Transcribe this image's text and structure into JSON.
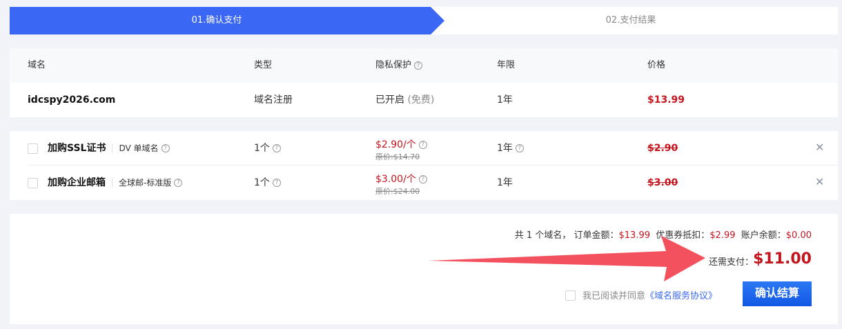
{
  "steps": {
    "step1": "01.确认支付",
    "step2": "02.支付结果"
  },
  "domain_table": {
    "headers": {
      "domain": "域名",
      "type": "类型",
      "privacy": "隐私保护",
      "years": "年限",
      "price": "价格"
    },
    "row": {
      "domain": "idcspy2026.com",
      "type": "域名注册",
      "privacy": "已开启",
      "privacy_note": "(免费)",
      "years": "1年",
      "price": "$13.99"
    }
  },
  "addons": [
    {
      "title": "加购SSL证书",
      "sub": "DV 单域名",
      "qty": "1个",
      "price": "$2.90/个",
      "original": "原价:$14.70",
      "years": "1年",
      "total": "$2.90"
    },
    {
      "title": "加购企业邮箱",
      "sub": "全球邮-标准版",
      "qty": "1个",
      "price": "$3.00/个",
      "original": "原价:$24.00",
      "years": "1年",
      "total": "$3.00"
    }
  ],
  "summary": {
    "count_text": "共 1 个域名，",
    "order_label": "订单金额：",
    "order_value": "$13.99",
    "coupon_label": "优惠券抵扣：",
    "coupon_value": "$2.99",
    "balance_label": "账户余额：",
    "balance_value": "$0.00",
    "topay_label": "还需支付：",
    "topay_value": "$11.00",
    "agree_text": "我已阅读并同意",
    "agree_link": "《域名服务协议》",
    "confirm_button": "确认结算"
  },
  "icons": {
    "help": "question-circle-icon",
    "close": "close-icon"
  },
  "colors": {
    "accent": "#3a68f5",
    "price": "#c4141e",
    "arrow": "#f4515e"
  }
}
